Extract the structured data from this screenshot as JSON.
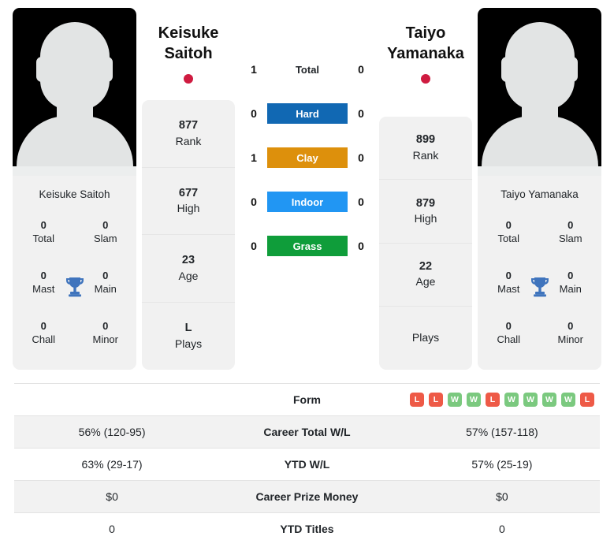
{
  "players": {
    "left": {
      "first_name": "Keisuke",
      "last_name": "Saitoh",
      "full_name": "Keisuke Saitoh",
      "flag": "japan-flag",
      "rank": "877",
      "rank_label": "Rank",
      "high": "677",
      "high_label": "High",
      "age": "23",
      "age_label": "Age",
      "plays": "L",
      "plays_label": "Plays",
      "titles": {
        "total": "0",
        "total_label": "Total",
        "slam": "0",
        "slam_label": "Slam",
        "mast": "0",
        "mast_label": "Mast",
        "main": "0",
        "main_label": "Main",
        "chall": "0",
        "chall_label": "Chall",
        "minor": "0",
        "minor_label": "Minor"
      }
    },
    "right": {
      "first_name": "Taiyo",
      "last_name": "Yamanaka",
      "full_name": "Taiyo Yamanaka",
      "flag": "japan-flag",
      "rank": "899",
      "rank_label": "Rank",
      "high": "879",
      "high_label": "High",
      "age": "22",
      "age_label": "Age",
      "plays": "",
      "plays_label": "Plays",
      "titles": {
        "total": "0",
        "total_label": "Total",
        "slam": "0",
        "slam_label": "Slam",
        "mast": "0",
        "mast_label": "Mast",
        "main": "0",
        "main_label": "Main",
        "chall": "0",
        "chall_label": "Chall",
        "minor": "0",
        "minor_label": "Minor"
      }
    }
  },
  "h2h": {
    "rows": [
      {
        "label": "Total",
        "left": "1",
        "right": "0",
        "type": "plain",
        "color": ""
      },
      {
        "label": "Hard",
        "left": "0",
        "right": "0",
        "type": "badge",
        "color": "#1168b3"
      },
      {
        "label": "Clay",
        "left": "1",
        "right": "0",
        "type": "badge",
        "color": "#dd900c"
      },
      {
        "label": "Indoor",
        "left": "0",
        "right": "0",
        "type": "badge",
        "color": "#2196f3"
      },
      {
        "label": "Grass",
        "left": "0",
        "right": "0",
        "type": "badge",
        "color": "#0f9d3a"
      }
    ]
  },
  "table": {
    "rows": [
      {
        "label": "Form",
        "type": "form",
        "left_form": [],
        "right_form": [
          "L",
          "L",
          "W",
          "W",
          "L",
          "W",
          "W",
          "W",
          "W",
          "L"
        ],
        "left": "",
        "right": "",
        "shaded": false
      },
      {
        "label": "Career Total W/L",
        "type": "text",
        "left": "56% (120-95)",
        "right": "57% (157-118)",
        "shaded": true
      },
      {
        "label": "YTD W/L",
        "type": "text",
        "left": "63% (29-17)",
        "right": "57% (25-19)",
        "shaded": false
      },
      {
        "label": "Career Prize Money",
        "type": "text",
        "left": "$0",
        "right": "$0",
        "shaded": true
      },
      {
        "label": "YTD Titles",
        "type": "text",
        "left": "0",
        "right": "0",
        "shaded": false
      }
    ]
  },
  "colors": {
    "win_badge": "#7bc97f",
    "loss_badge": "#ee5a47",
    "trophy": "#3f74bd",
    "flag_disc": "#cf1b40",
    "card_bg": "#f1f1f1"
  }
}
